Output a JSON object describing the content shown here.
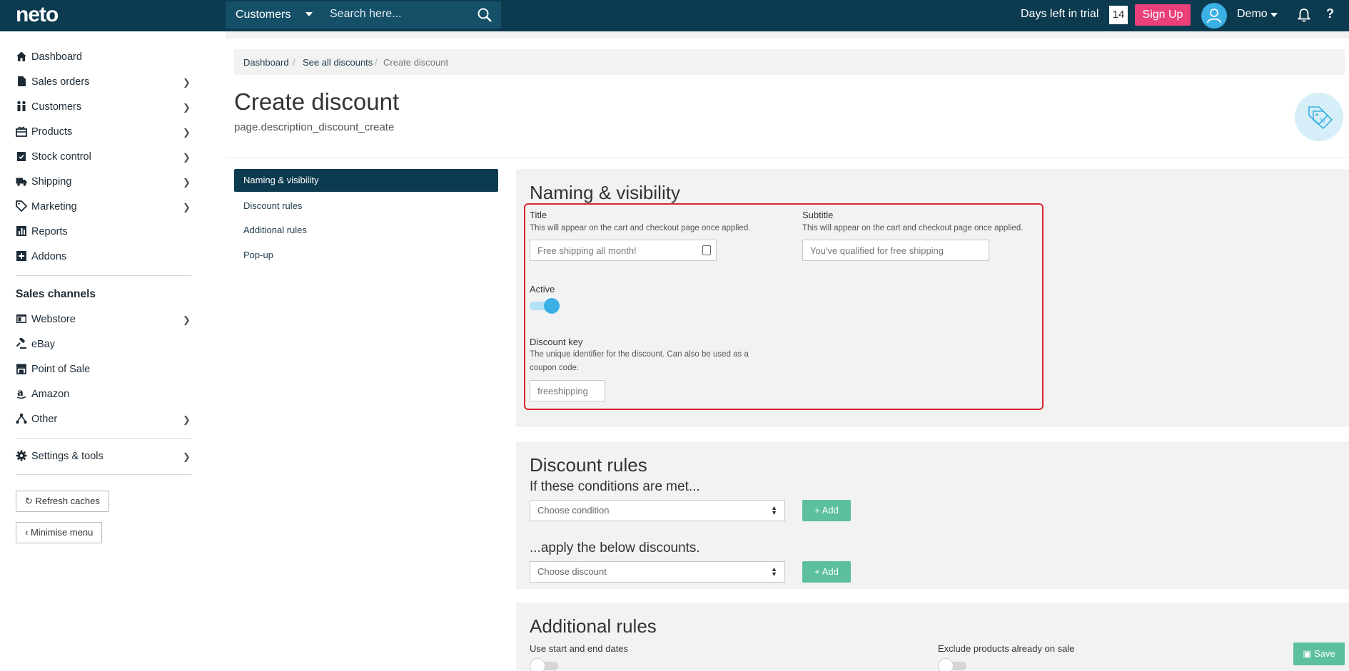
{
  "topbar": {
    "logo": "neto",
    "search_scope": "Customers",
    "search_placeholder": "Search here...",
    "trial_label": "Days left in trial",
    "trial_days": "14",
    "signup_label": "Sign Up",
    "user_name": "Demo",
    "help_label": "?"
  },
  "sidebar": {
    "items": [
      {
        "label": "Dashboard",
        "icon": "home-icon"
      },
      {
        "label": "Sales orders",
        "icon": "document-icon"
      },
      {
        "label": "Customers",
        "icon": "people-icon"
      },
      {
        "label": "Products",
        "icon": "gift-icon"
      },
      {
        "label": "Stock control",
        "icon": "clipboard-check-icon"
      },
      {
        "label": "Shipping",
        "icon": "truck-icon"
      },
      {
        "label": "Marketing",
        "icon": "tag-icon"
      },
      {
        "label": "Reports",
        "icon": "chart-icon"
      },
      {
        "label": "Addons",
        "icon": "plus-square-icon"
      }
    ],
    "channels_heading": "Sales channels",
    "channels": [
      {
        "label": "Webstore",
        "icon": "webstore-icon"
      },
      {
        "label": "eBay",
        "icon": "gavel-icon"
      },
      {
        "label": "Point of Sale",
        "icon": "store-icon"
      },
      {
        "label": "Amazon",
        "icon": "amazon-icon"
      },
      {
        "label": "Other",
        "icon": "network-icon"
      }
    ],
    "settings_label": "Settings & tools",
    "refresh_label": "Refresh caches",
    "minimise_label": "Minimise menu"
  },
  "breadcrumb": {
    "items": [
      "Dashboard",
      "See all discounts",
      "Create discount"
    ]
  },
  "page": {
    "title": "Create discount",
    "description": "page.description_discount_create"
  },
  "section_tabs": [
    "Naming & visibility",
    "Discount rules",
    "Additional rules",
    "Pop-up"
  ],
  "naming": {
    "heading": "Naming & visibility",
    "title_label": "Title",
    "title_help": "This will appear on the cart and checkout page once applied.",
    "title_placeholder": "Free shipping all month!",
    "subtitle_label": "Subtitle",
    "subtitle_help": "This will appear on the cart and checkout page once applied.",
    "subtitle_placeholder": "You've qualified for free shipping",
    "active_label": "Active",
    "active": true,
    "key_label": "Discount key",
    "key_help": "The unique identifier for the discount. Can also be used as a coupon code.",
    "key_placeholder": "freeshipping"
  },
  "rules": {
    "heading": "Discount rules",
    "conditions_heading": "If these conditions are met...",
    "condition_placeholder": "Choose condition",
    "discounts_heading": "...apply the below discounts.",
    "discount_placeholder": "Choose discount",
    "add_label": "Add"
  },
  "additional": {
    "heading": "Additional rules",
    "dates_label": "Use start and end dates",
    "exclude_label": "Exclude products already on sale"
  },
  "save_label": "Save",
  "colors": {
    "topbar": "#0c3a4f",
    "signup": "#e9407a",
    "accent": "#3ab0e4",
    "add_button": "#5cbfa0",
    "highlight": "#d9262f"
  }
}
